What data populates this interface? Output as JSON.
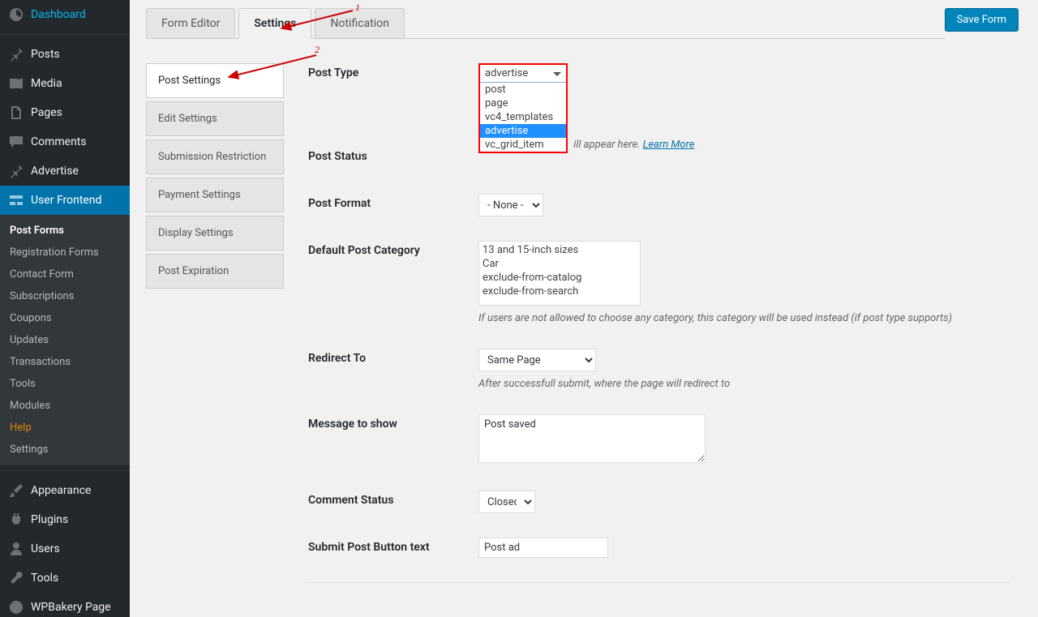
{
  "sidebar": {
    "items": [
      {
        "label": "Dashboard",
        "key": "dashboard"
      },
      {
        "label": "Posts",
        "key": "posts"
      },
      {
        "label": "Media",
        "key": "media"
      },
      {
        "label": "Pages",
        "key": "pages"
      },
      {
        "label": "Comments",
        "key": "comments"
      },
      {
        "label": "Advertise",
        "key": "advertise"
      },
      {
        "label": "User Frontend",
        "key": "user-frontend"
      },
      {
        "label": "Appearance",
        "key": "appearance"
      },
      {
        "label": "Plugins",
        "key": "plugins"
      },
      {
        "label": "Users",
        "key": "users"
      },
      {
        "label": "Tools",
        "key": "tools"
      },
      {
        "label": "WPBakery Page",
        "key": "wpbakery"
      }
    ],
    "sub": [
      {
        "label": "Post Forms"
      },
      {
        "label": "Registration Forms"
      },
      {
        "label": "Contact Form"
      },
      {
        "label": "Subscriptions"
      },
      {
        "label": "Coupons"
      },
      {
        "label": "Updates"
      },
      {
        "label": "Transactions"
      },
      {
        "label": "Tools"
      },
      {
        "label": "Modules"
      },
      {
        "label": "Help"
      },
      {
        "label": "Settings"
      }
    ]
  },
  "tabs": {
    "form_editor": "Form Editor",
    "settings": "Settings",
    "notification": "Notification"
  },
  "save_button": "Save Form",
  "side_tabs": [
    "Post Settings",
    "Edit Settings",
    "Submission Restriction",
    "Payment Settings",
    "Display Settings",
    "Post Expiration"
  ],
  "annotations": {
    "num1": "1",
    "num2": "2"
  },
  "post_type": {
    "label": "Post Type",
    "selected": "advertise",
    "options": [
      "post",
      "page",
      "vc4_templates",
      "advertise",
      "vc_grid_item"
    ],
    "hint_suffix": "ill appear here. ",
    "learn_more": "Learn More"
  },
  "post_status": {
    "label": "Post Status"
  },
  "post_format": {
    "label": "Post Format",
    "value": "- None -"
  },
  "default_cat": {
    "label": "Default Post Category",
    "items": [
      "13 and 15-inch sizes",
      "Car",
      "exclude-from-catalog",
      "exclude-from-search"
    ],
    "hint": "If users are not allowed to choose any category, this category will be used instead (if post type supports)"
  },
  "redirect": {
    "label": "Redirect To",
    "value": "Same Page",
    "hint": "After successfull submit, where the page will redirect to"
  },
  "message": {
    "label": "Message to show",
    "value": "Post saved"
  },
  "comment": {
    "label": "Comment Status",
    "value": "Closed"
  },
  "submit_btn": {
    "label": "Submit Post Button text",
    "value": "Post ad"
  }
}
